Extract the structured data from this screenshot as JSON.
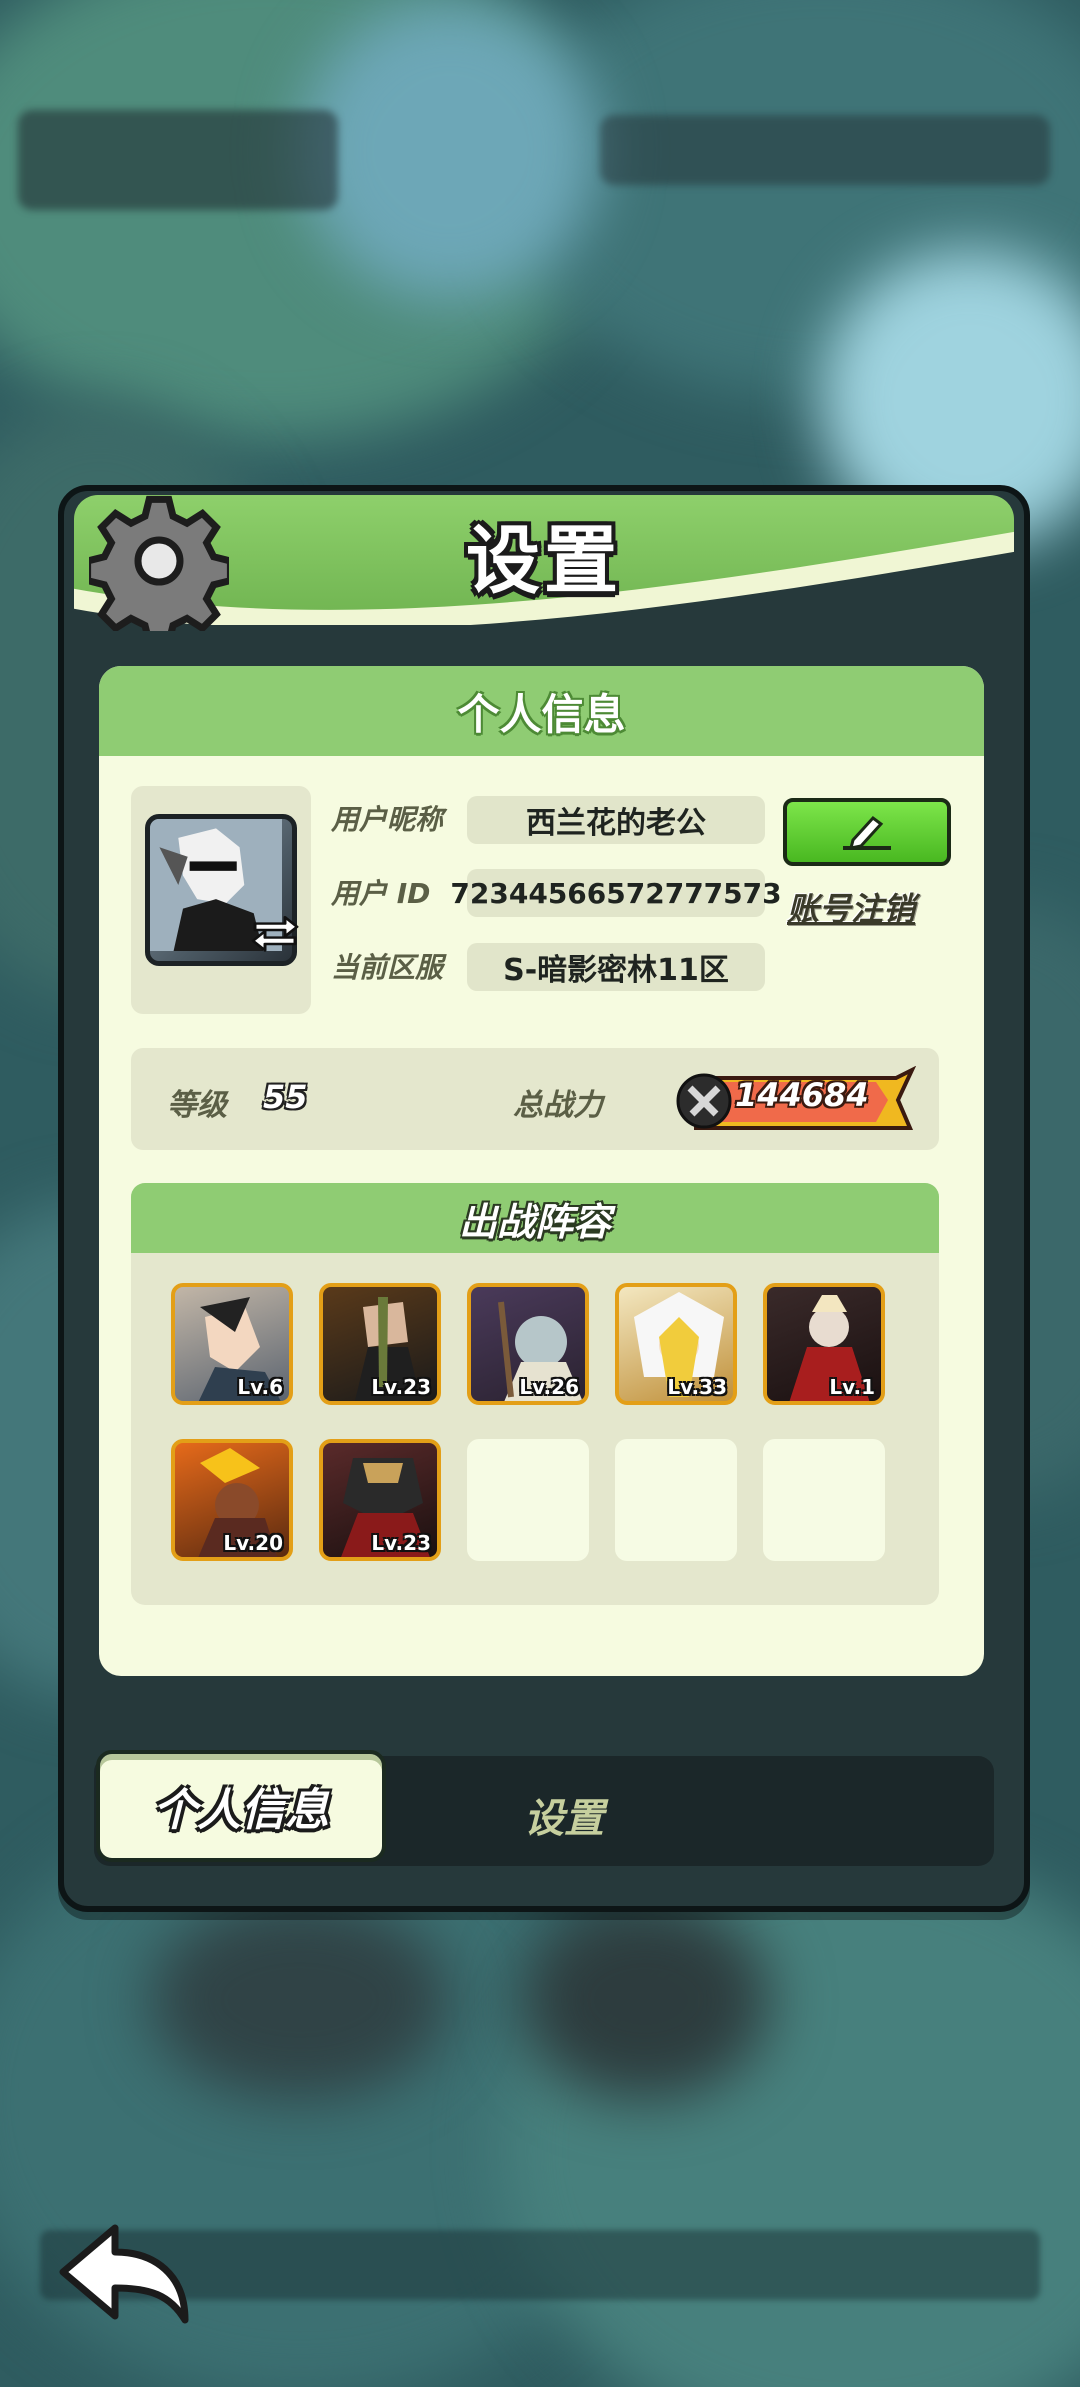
{
  "dialog": {
    "title": "设置"
  },
  "profile": {
    "section_title": "个人信息",
    "nickname_label": "用户昵称",
    "nickname_value": "西兰花的老公",
    "id_label": "用户   ID",
    "id_value": "72344566572777573",
    "server_label": "当前区服",
    "server_value": "S-暗影密林11区",
    "cancel_account": "账号注销"
  },
  "stats": {
    "level_label": "等级",
    "level_value": "55",
    "power_label": "总战力",
    "power_value": "144684"
  },
  "lineup": {
    "title": "出战阵容",
    "heroes": [
      {
        "level": "Lv.6",
        "color": "#7a5a3a"
      },
      {
        "level": "Lv.23",
        "color": "#6a4a2a"
      },
      {
        "level": "Lv.26",
        "color": "#5a4a5a"
      },
      {
        "level": "Lv.33",
        "color": "#a07a3a"
      },
      {
        "level": "Lv.1",
        "color": "#6a2a2a"
      },
      {
        "level": "Lv.20",
        "color": "#b05a20"
      },
      {
        "level": "Lv.23",
        "color": "#4a2a2a"
      }
    ]
  },
  "tabs": {
    "active": "个人信息",
    "other": "设置"
  },
  "colors": {
    "accent_green": "#8fcc73",
    "panel_bg": "#f6fbe0",
    "hero_border": "#e39f17"
  },
  "icons": [
    "gear-icon",
    "swap-icon",
    "edit-pencil-icon",
    "sword-icon",
    "back-arrow-icon"
  ]
}
